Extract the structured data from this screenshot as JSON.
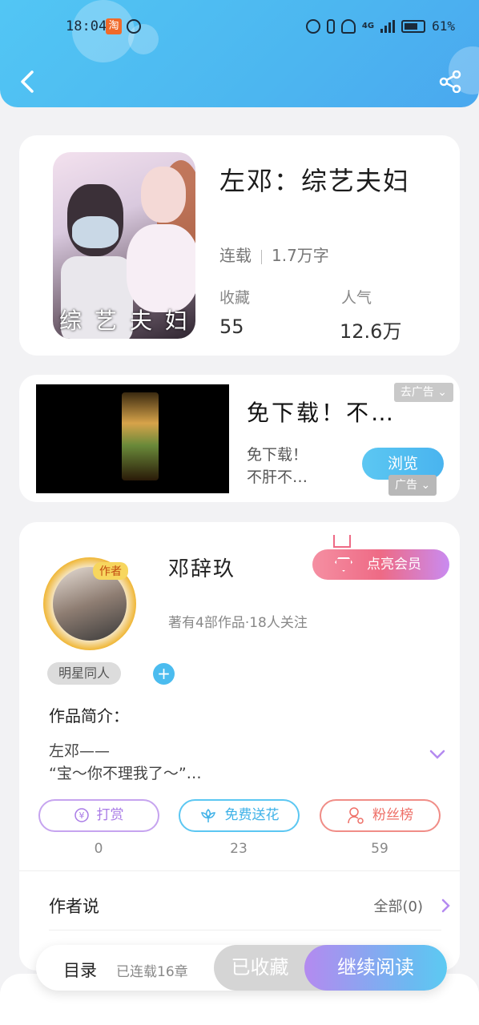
{
  "status_bar": {
    "time": "18:04",
    "app_icon_text": "淘",
    "battery": "61%",
    "network": "4G"
  },
  "book": {
    "title": "左邓：综艺夫妇",
    "status": "连载",
    "word_count": "1.7万字",
    "favorites_label": "收藏",
    "favorites_value": "55",
    "popularity_label": "人气",
    "popularity_value": "12.6万",
    "cover_text": [
      "综",
      "艺",
      "夫",
      "妇"
    ]
  },
  "ad": {
    "title": "免下载！不…",
    "description": "免下载！\n不肝不…",
    "close_label": "去广告",
    "browse_label": "浏览",
    "ad_tag": "广告"
  },
  "author": {
    "badge": "作者",
    "name": "邓辞玖",
    "stats": "著有4部作品·18人关注",
    "vip_button": "点亮会员",
    "tag": "明星同人",
    "add_tag": "+",
    "intro_label": "作品简介：",
    "intro_text": "左邓——\n“宝～你不理我了～”…",
    "actions": [
      {
        "label": "打赏",
        "count": "0",
        "icon": "yuan-coin-icon"
      },
      {
        "label": "免费送花",
        "count": "23",
        "icon": "flower-icon"
      },
      {
        "label": "粉丝榜",
        "count": "59",
        "icon": "user-rank-icon"
      }
    ],
    "author_says_label": "作者说",
    "all_label": "全部(0)"
  },
  "bottom_bar": {
    "toc_label": "目录",
    "toc_count": "已连载16章",
    "collected_label": "已收藏",
    "read_label": "继续阅读"
  },
  "colors": {
    "header_gradient": [
      "#52c6f4",
      "#4aa8ef"
    ],
    "accent_blue": "#4bbcef",
    "accent_purple": "#b48af0",
    "vip_pink": "#ee6a85"
  }
}
